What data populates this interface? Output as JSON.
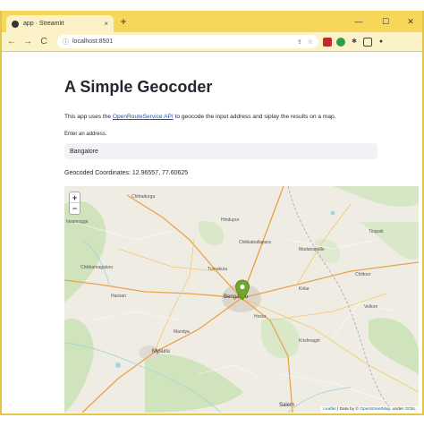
{
  "browser": {
    "tab_title": "app · Streamlit",
    "tab_close": "×",
    "new_tab": "+",
    "url": "localhost:8501",
    "window_controls": {
      "minimize": "—",
      "maximize": "☐",
      "close": "✕"
    },
    "nav": {
      "back": "←",
      "forward": "→",
      "reload": "C"
    },
    "accent": "#f6d75a"
  },
  "page": {
    "title": "A Simple Geocoder",
    "description_prefix": "This app uses the ",
    "description_link": "OpenRouteService API",
    "description_suffix": " to geocode the input address and siplay the results on a map.",
    "input_label": "Enter an address.",
    "input_value": "Bangalore",
    "coordinates": "Geocoded Coordinates: 12.96557, 77.60625"
  },
  "map": {
    "zoom_in": "+",
    "zoom_out": "−",
    "marker_color": "#6fa728",
    "attribution_prefix": "Leaflet",
    "attribution_middle": " | Data by © ",
    "attribution_osm": "OpenStreetMap",
    "attribution_under": ", under ",
    "attribution_odbl": "ODbL",
    "labels": {
      "bengaluru": "Bengaluru",
      "mysuru": "Mysuru",
      "shivamogga": "hivamogga",
      "chikkamagaluru": "Chikkamagaluru",
      "hassan": "Hassan",
      "tumakuru": "Tumakuru",
      "hosur": "Hosur",
      "salem": "Salem",
      "chitradurga": "Chitradurga",
      "chikkaballapura": "Chikkaballapura",
      "kolar": "Kolar",
      "madanapalle": "Madanapalle",
      "chittoor": "Chittoor",
      "vellore": "Vellore",
      "krishnagiri": "Krishnagiri",
      "mandya": "Mandya",
      "tirupati": "Tirupati",
      "hindupur": "Hindupur"
    }
  }
}
